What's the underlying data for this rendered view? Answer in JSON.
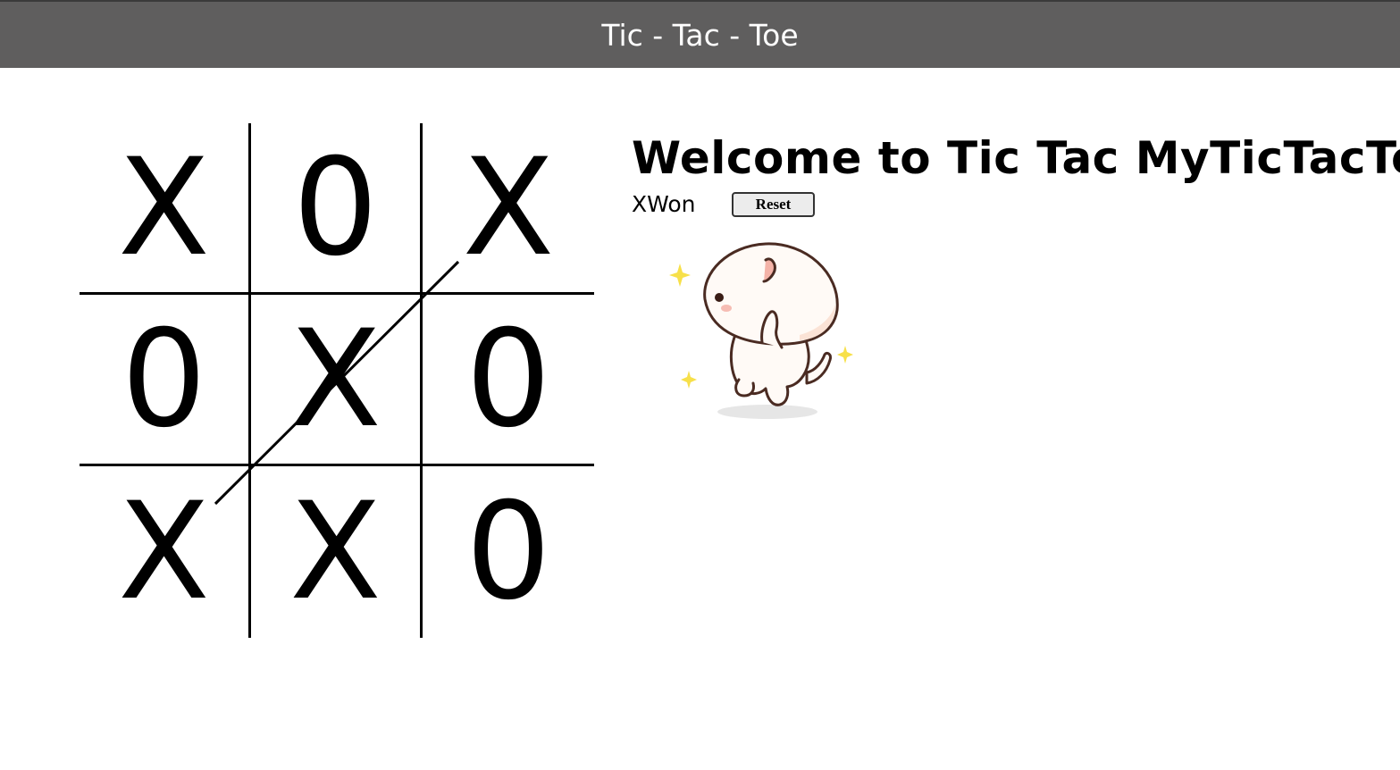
{
  "header": {
    "title": "Tic - Tac - Toe"
  },
  "welcome": {
    "text": "Welcome to Tic Tac MyTicTacToe"
  },
  "status": {
    "text": "XWon"
  },
  "reset": {
    "label": "Reset"
  },
  "board": {
    "cells": [
      "X",
      "0",
      "X",
      "0",
      "X",
      "0",
      "X",
      "X",
      "0"
    ],
    "winning_line": "diagonal from bottom-left cell to top-right cell"
  },
  "image": {
    "icon": "cat-sticker"
  }
}
